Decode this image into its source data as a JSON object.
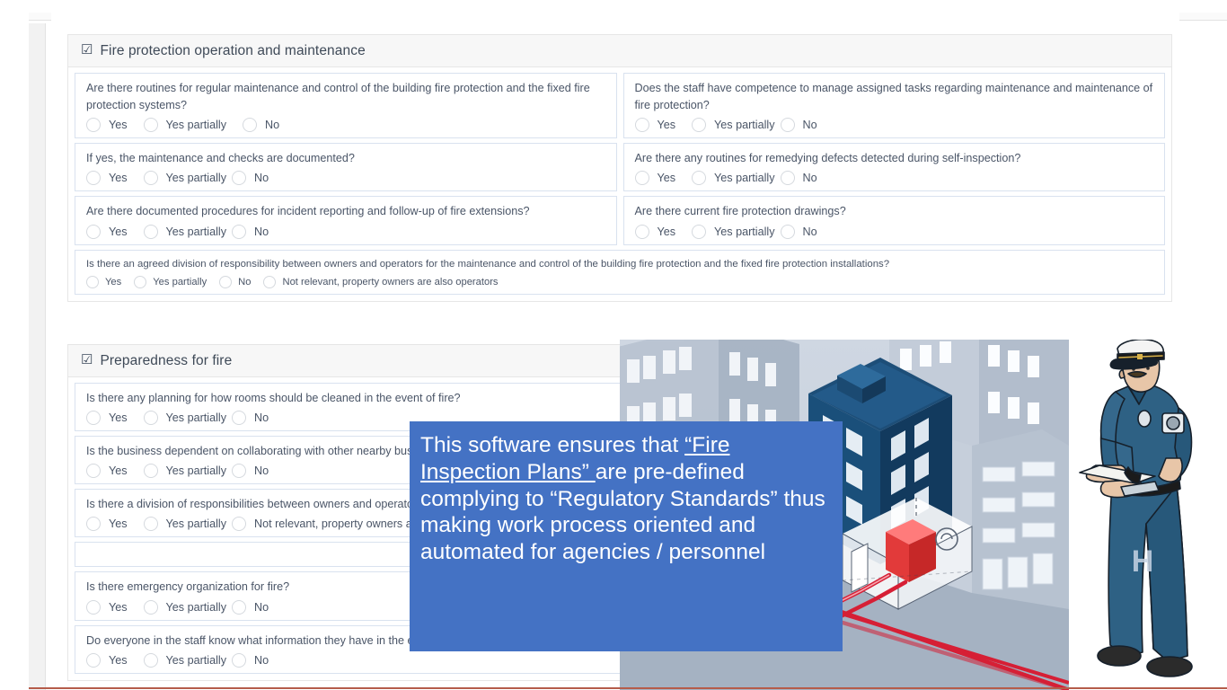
{
  "sections": [
    {
      "id": "fire-protection-operation-and-maintenance",
      "checkbox_icon": "checked-checkbox-icon",
      "checkbox_glyph": "☑",
      "title": "Fire protection operation and maintenance",
      "rows": [
        {
          "questions": [
            {
              "text": "Are there routines for regular maintenance and control of the building fire protection and the fixed fire protection systems?",
              "options": [
                "Yes",
                "Yes partially",
                "No"
              ],
              "spacing": "wide"
            },
            {
              "text": "Does the staff have competence to manage assigned tasks regarding maintenance and maintenance of fire protection?",
              "options": [
                "Yes",
                "Yes partially",
                "No"
              ],
              "spacing": "tight"
            }
          ]
        },
        {
          "questions": [
            {
              "text": "If yes, the maintenance and checks are documented?",
              "options": [
                "Yes",
                "Yes partially",
                "No"
              ],
              "spacing": "tight"
            },
            {
              "text": "Are there any routines for remedying defects detected during self-inspection?",
              "options": [
                "Yes",
                "Yes partially",
                "No"
              ],
              "spacing": "tight"
            }
          ]
        },
        {
          "questions": [
            {
              "text": "Are there documented procedures for incident reporting and follow-up of fire extensions?",
              "options": [
                "Yes",
                "Yes partially",
                "No"
              ],
              "spacing": "tight"
            },
            {
              "text": "Are there current fire protection drawings?",
              "options": [
                "Yes",
                "Yes partially",
                "No"
              ],
              "spacing": "tight"
            }
          ]
        },
        {
          "questions": [
            {
              "text": "Is there an agreed division of responsibility between owners and operators for the maintenance and control of the building fire protection and the fixed fire protection installations?",
              "options": [
                "Yes",
                "Yes partially",
                "No",
                "Not relevant, property owners are also operators"
              ],
              "spacing": "tight",
              "full_width": true,
              "small": true
            }
          ]
        }
      ]
    },
    {
      "id": "preparedness-for-fire",
      "checkbox_icon": "checked-checkbox-icon",
      "checkbox_glyph": "☑",
      "title": "Preparedness for fire",
      "rows": [
        {
          "questions": [
            {
              "text": "Is there any planning for how rooms should be cleaned in the event of fire?",
              "options": [
                "Yes",
                "Yes partially",
                "No"
              ],
              "spacing": "tight"
            }
          ]
        },
        {
          "questions": [
            {
              "text": "Is the business dependent on collaborating with other nearby businesses in the event of a fire?",
              "options": [
                "Yes",
                "Yes partially",
                "No"
              ],
              "spacing": "tight"
            }
          ]
        },
        {
          "questions": [
            {
              "text": "Is there a division of responsibilities between owners and operators?",
              "options": [
                "Yes",
                "Yes partially",
                "Not relevant, property owners are also operators"
              ],
              "spacing": "tight"
            }
          ]
        },
        {
          "questions": [
            {
              "text": "",
              "options": [],
              "empty": true
            }
          ]
        },
        {
          "questions": [
            {
              "text": "Is there emergency organization for fire?",
              "options": [
                "Yes",
                "Yes partially",
                "No"
              ],
              "spacing": "tight"
            }
          ]
        },
        {
          "questions": [
            {
              "text": "Do everyone in the staff know what information they have in the event of a fire?",
              "options": [
                "Yes",
                "Yes partially",
                "No"
              ],
              "spacing": "tight"
            }
          ]
        }
      ]
    }
  ],
  "callout": {
    "line_1": "This software ensures that ",
    "emphasis_1": "“Fire Inspection Plans” ",
    "line_2": "are pre-defined complying to “Regulatory Standards” thus making work process oriented and automated for agencies / personnel",
    "background_color": "#4472C4",
    "text_color": "#FFFFFF"
  },
  "illustration": {
    "name": "isometric-city-fire-sprinkler-diagram",
    "alt": "Isometric city block with a highlighted dark blue building showing a red fire pump and red sprinkler piping running underground",
    "colors": {
      "sky": "#c9d2de",
      "ground": "#aab6c6",
      "highlight_building": "#1d4e78",
      "pipe_red": "#d61f35",
      "pump_red": "#f0474f"
    }
  },
  "officer": {
    "name": "fire-inspector-illustration",
    "alt": "Fire inspector in blue uniform with peaked cap holding a clipboard",
    "colors": {
      "uniform": "#2e6184",
      "uniform_shadow": "#23506f",
      "skin": "#e8c6a8",
      "cap": "#f2f2f2",
      "shoes": "#2b2b2b"
    }
  },
  "chrome": {
    "accent_line_color": "#B55C4A",
    "strip_color": "#F2F2F2"
  }
}
